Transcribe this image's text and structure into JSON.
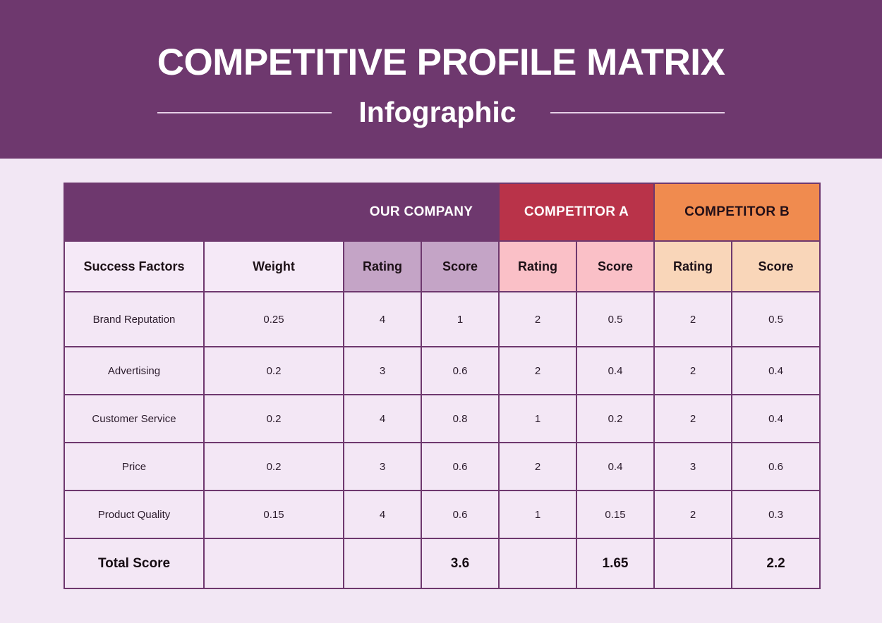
{
  "banner": {
    "title": "COMPETITIVE PROFILE MATRIX",
    "subtitle": "Infographic",
    "background_color": "#6E386E",
    "text_color": "#FFFFFF",
    "rule_color": "#E5CFE6"
  },
  "page": {
    "background_color": "#F2E7F4"
  },
  "table": {
    "border_color": "#6E386E",
    "groups": [
      {
        "label": "",
        "span": 2,
        "background": "#6E386E",
        "color": "#6E386E"
      },
      {
        "label": "OUR COMPANY",
        "span": 2,
        "background": "#6E386E",
        "color": "#FFFFFF"
      },
      {
        "label": "COMPETITOR A",
        "span": 2,
        "background": "#B93349",
        "color": "#FFFFFF"
      },
      {
        "label": "COMPETITOR B",
        "span": 2,
        "background": "#F08B4F",
        "color": "#231018"
      }
    ],
    "columns": [
      {
        "label": "Success Factors",
        "background": "#F5E9F7"
      },
      {
        "label": "Weight",
        "background": "#F5E9F7"
      },
      {
        "label": "Rating",
        "background": "#C4A4C6"
      },
      {
        "label": "Score",
        "background": "#C4A4C6"
      },
      {
        "label": "Rating",
        "background": "#FAC0C7"
      },
      {
        "label": "Score",
        "background": "#FAC0C7"
      },
      {
        "label": "Rating",
        "background": "#F9D6B9"
      },
      {
        "label": "Score",
        "background": "#F9D6B9"
      }
    ],
    "rows": [
      {
        "factor": "Brand Reputation",
        "weight": "0.25",
        "our_rating": "4",
        "our_score": "1",
        "a_rating": "2",
        "a_score": "0.5",
        "b_rating": "2",
        "b_score": "0.5"
      },
      {
        "factor": "Advertising",
        "weight": "0.2",
        "our_rating": "3",
        "our_score": "0.6",
        "a_rating": "2",
        "a_score": "0.4",
        "b_rating": "2",
        "b_score": "0.4"
      },
      {
        "factor": "Customer Service",
        "weight": "0.2",
        "our_rating": "4",
        "our_score": "0.8",
        "a_rating": "1",
        "a_score": "0.2",
        "b_rating": "2",
        "b_score": "0.4"
      },
      {
        "factor": "Price",
        "weight": "0.2",
        "our_rating": "3",
        "our_score": "0.6",
        "a_rating": "2",
        "a_score": "0.4",
        "b_rating": "3",
        "b_score": "0.6"
      },
      {
        "factor": "Product Quality",
        "weight": "0.15",
        "our_rating": "4",
        "our_score": "0.6",
        "a_rating": "1",
        "a_score": "0.15",
        "b_rating": "2",
        "b_score": "0.3"
      }
    ],
    "total": {
      "label": "Total Score",
      "weight": "",
      "our_rating": "",
      "our_score": "3.6",
      "a_rating": "",
      "a_score": "1.65",
      "b_rating": "",
      "b_score": "2.2"
    }
  }
}
